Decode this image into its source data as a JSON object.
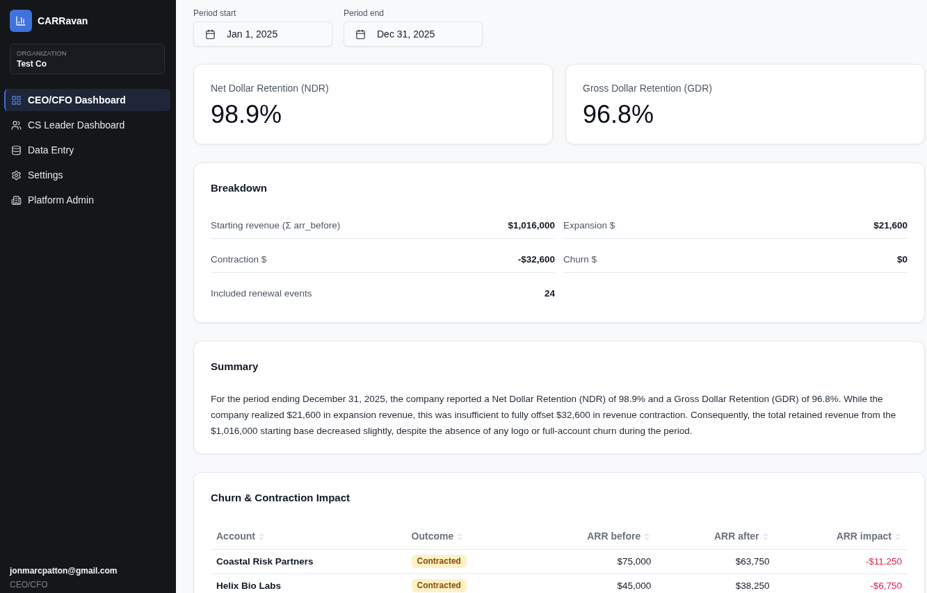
{
  "sidebar": {
    "brand": "CARRavan",
    "organization": {
      "label": "ORGANIZATION",
      "name": "Test Co"
    },
    "nav": [
      {
        "label": "CEO/CFO Dashboard",
        "selected": true
      },
      {
        "label": "CS Leader Dashboard",
        "selected": false
      },
      {
        "label": "Data Entry",
        "selected": false
      },
      {
        "label": "Settings",
        "selected": false
      },
      {
        "label": "Platform Admin",
        "selected": false
      }
    ],
    "user": {
      "email": "jonmarcpatton@gmail.com",
      "role": "CEO/CFO"
    }
  },
  "period": [
    {
      "label": "Period start",
      "value": "Jan 1, 2025"
    },
    {
      "label": "Period end",
      "value": "Dec 31, 2025"
    }
  ],
  "kpis": [
    {
      "label": "Net Dollar Retention (NDR)",
      "value": "98.9%"
    },
    {
      "label": "Gross Dollar Retention (GDR)",
      "value": "96.8%"
    }
  ],
  "breakdown": {
    "title": "Breakdown",
    "items": [
      {
        "label": "Starting revenue (Σ arr_before)",
        "value": "$1,016,000"
      },
      {
        "label": "Expansion $",
        "value": "$21,600"
      },
      {
        "label": "Contraction $",
        "value": "-$32,600"
      },
      {
        "label": "Churn $",
        "value": "$0"
      },
      {
        "label": "Included renewal events",
        "value": "24"
      }
    ]
  },
  "summary": {
    "title": "Summary",
    "text": "For the period ending December 31, 2025, the company reported a Net Dollar Retention (NDR) of 98.9% and a Gross Dollar Retention (GDR) of 96.8%. While the company realized $21,600 in expansion revenue, this was insufficient to fully offset $32,600 in revenue contraction. Consequently, the total retained revenue from the $1,016,000 starting base decreased slightly, despite the absence of any logo or full-account churn during the period."
  },
  "impact": {
    "title": "Churn & Contraction Impact",
    "columns": [
      "Account",
      "Outcome",
      "ARR before",
      "ARR after",
      "ARR impact"
    ],
    "rows": [
      {
        "account": "Coastal Risk Partners",
        "outcome": "Contracted",
        "arr_before": "$75,000",
        "arr_after": "$63,750",
        "arr_impact": "-$11,250"
      },
      {
        "account": "Helix Bio Labs",
        "outcome": "Contracted",
        "arr_before": "$45,000",
        "arr_after": "$38,250",
        "arr_impact": "-$6,750"
      }
    ]
  }
}
